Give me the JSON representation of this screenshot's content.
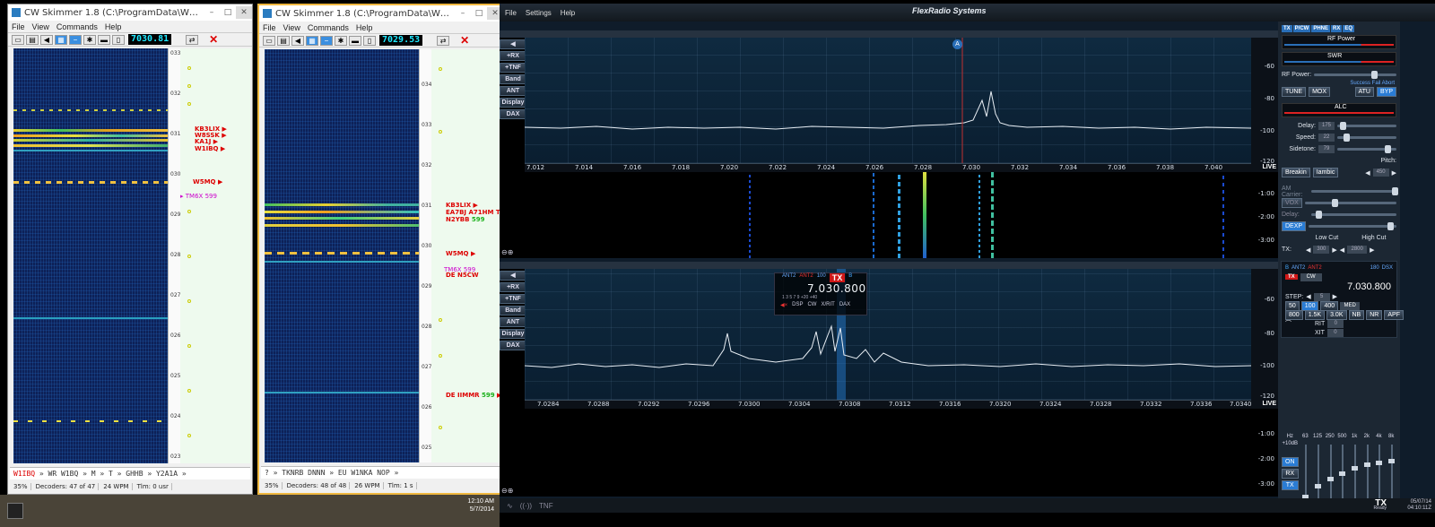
{
  "skimmer1": {
    "title": "CW Skimmer 1.8 (C:\\ProgramData\\W2RF\\IQ2.ini) - Regist...",
    "menu": [
      "File",
      "View",
      "Commands",
      "Help"
    ],
    "freq": "7030.81",
    "scale": [
      "033",
      "032",
      "031",
      "030",
      "029",
      "028",
      "027",
      "026",
      "025",
      "024",
      "023"
    ],
    "calls": [
      {
        "text": "KB3LIX",
        "snr": "",
        "mag": false
      },
      {
        "text": "W8SSK",
        "snr": "",
        "mag": false
      },
      {
        "text": "KA1J",
        "snr": "",
        "mag": false
      },
      {
        "text": "W1IBQ",
        "snr": "",
        "mag": false
      },
      {
        "text": "W5MQ",
        "snr": "",
        "mag": false
      },
      {
        "text": "TM6X",
        "snr": "599",
        "mag": true
      }
    ],
    "decode": [
      "W1IBQ",
      "» WR W1BQ » M » T » GHHB » Y2A1A »"
    ],
    "status": [
      "35%",
      "Decoders: 47 of 47",
      "24 WPM",
      "Tlm: 0 usr"
    ]
  },
  "skimmer2": {
    "title": "CW Skimmer 1.8 (C:\\ProgramData\\W2RF\\IQ1.ini) - Reg...",
    "menu": [
      "File",
      "View",
      "Commands",
      "Help"
    ],
    "freq": "7029.53",
    "scale": [
      "034",
      "033",
      "032",
      "031",
      "030",
      "029",
      "028",
      "027",
      "026",
      "025"
    ],
    "calls": [
      {
        "text": "KB3LIX",
        "snr": "",
        "mag": false
      },
      {
        "text": "EA7BJ A71HM T",
        "snr": "",
        "mag": false
      },
      {
        "text": "N2YBB",
        "snr": "599",
        "mag": false
      },
      {
        "text": "W5MQ",
        "snr": "",
        "mag": false
      },
      {
        "text": "TM6X",
        "snr": "599",
        "mag": true
      },
      {
        "text": "DE N5CW",
        "snr": "",
        "mag": false
      },
      {
        "text": "DE IIMMR",
        "snr": "599",
        "mag": false
      }
    ],
    "decode": [
      "? » TKNRB DNNN » EU W1NKA NOP »"
    ],
    "status": [
      "35%",
      "Decoders: 48 of 48",
      "26 WPM",
      "Tlm: 1 s"
    ]
  },
  "taskbar": {
    "time": "12:10 AM",
    "date": "5/7/2014"
  },
  "flex": {
    "menu": [
      "File",
      "Settings",
      "Help"
    ],
    "brand": "FlexRadio Systems",
    "side_buttons": [
      "+RX",
      "+TNF",
      "Band",
      "ANT",
      "Display",
      "DAX"
    ],
    "pan1": {
      "freqs": [
        "7.012",
        "7.014",
        "7.016",
        "7.018",
        "7.020",
        "7.022",
        "7.024",
        "7.026",
        "7.028",
        "7.030",
        "7.032",
        "7.034",
        "7.036",
        "7.038",
        "7.040"
      ],
      "dbm": [
        "-60",
        "-80",
        "-100",
        "-120"
      ],
      "wf_time": [
        "-1:00",
        "-2:00",
        "-3:00"
      ],
      "live": "LIVE",
      "slice_letter": "A"
    },
    "pan2": {
      "freqs": [
        "7.0284",
        "7.0288",
        "7.0292",
        "7.0296",
        "7.0300",
        "7.0304",
        "7.0308",
        "7.0312",
        "7.0316",
        "7.0320",
        "7.0324",
        "7.0328",
        "7.0332",
        "7.0336",
        "7.0340"
      ],
      "dbm": [
        "-60",
        "-80",
        "-100",
        "-120"
      ],
      "wf_time": [
        "-1:00",
        "-2:00",
        "-3:00"
      ],
      "live": "LIVE"
    },
    "slice": {
      "ant1": "ANT2",
      "ant2": "ANT2",
      "rate": "100",
      "tx": "TX",
      "letter": "B",
      "freq": "7.030.800",
      "scale": "1 3 5 7 9 +20 +40",
      "buttons": [
        "DSP",
        "CW",
        "X/RIT",
        "DAX"
      ]
    },
    "bottom": {
      "tnf": "TNF"
    },
    "control": {
      "tabs": [
        "TX",
        "P/CW",
        "PHNE",
        "RX",
        "EQ"
      ],
      "rf_power_meter": "RF Power",
      "swr_meter": "SWR",
      "rf_power_label": "RF Power:",
      "atu_status": "Success Fail Abort",
      "tx_buttons": [
        "TUNE",
        "MOX",
        "ATU",
        "BYP"
      ],
      "alc": "ALC",
      "delay_label": "Delay:",
      "delay": "175",
      "speed_label": "Speed:",
      "speed": "22",
      "sidetone_label": "Sidetone:",
      "sidetone": "79",
      "pitch_label": "Pitch:",
      "pitch": "450",
      "breakin": "Breakin",
      "iambic": "Iambic",
      "am_carrier": "AM Carrier:",
      "vox": "VOX",
      "delay2": "Delay:",
      "dexp": "DEXP",
      "low_cut": "Low Cut",
      "high_cut": "High Cut",
      "tx_label": "TX:",
      "low_cut_val": "300",
      "high_cut_val": "2800",
      "slice_ant1": "ANT2",
      "slice_ant2": "ANT2",
      "slice_rate": "180",
      "dsx": "DSX",
      "mode": "CW",
      "slice_freq": "7.030.800",
      "step_label": "STEP:",
      "step": "5",
      "filters": [
        "50",
        "100",
        "400",
        "800",
        "1.5K",
        "3.0K"
      ],
      "agc": "MED",
      "dsp_btns": [
        "NB",
        "NR",
        "APF"
      ],
      "rit": "RIT",
      "rit_val": "0",
      "xit": "XIT",
      "xit_val": "0",
      "eq_bands": [
        "Hz",
        "63",
        "125",
        "250",
        "500",
        "1k",
        "2k",
        "4k",
        "8k"
      ],
      "eq_gain": "+10dB",
      "eq_btns": [
        "ON",
        "RX",
        "TX"
      ],
      "tx_ready": "TX",
      "ready": "Ready",
      "date": "05/07/14",
      "utc": "04:10:11Z"
    }
  }
}
